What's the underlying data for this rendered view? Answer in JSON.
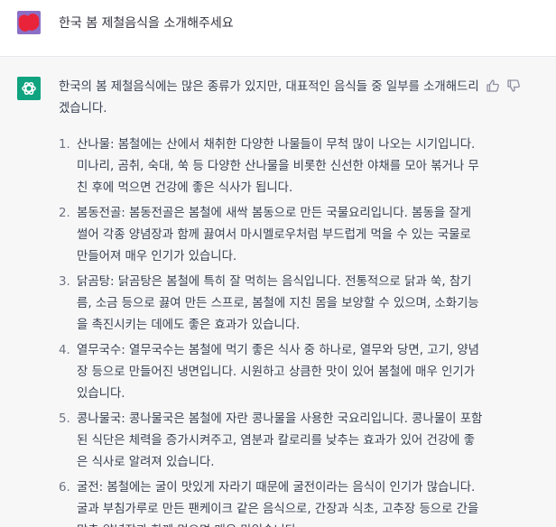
{
  "user_message": {
    "text": "한국 봄 제철음식을 소개해주세요",
    "avatar_color": "#8b6fc6"
  },
  "assistant_message": {
    "avatar_color": "#10a37f",
    "intro": "한국의 봄 제철음식에는 많은 종류가 있지만, 대표적인 음식들 중 일부를 소개해드리겠습니다.",
    "items": [
      {
        "num": "1.",
        "text": "산나물: 봄철에는 산에서 채취한 다양한 나물들이 무척 많이 나오는 시기입니다. 미나리, 곰취, 숙대, 쑥 등 다양한 산나물을 비롯한 신선한 야채를 모아 볶거나 무친 후에 먹으면 건강에 좋은 식사가 됩니다."
      },
      {
        "num": "2.",
        "text": "봄동전골: 봄동전골은 봄철에 새싹 봄동으로 만든 국물요리입니다. 봄동을 잘게 썰어 각종 양념장과 함께 끓여서 마시멜로우처럼 부드럽게 먹을 수 있는 국물로 만들어져 매우 인기가 있습니다."
      },
      {
        "num": "3.",
        "text": "닭곰탕: 닭곰탕은 봄철에 특히 잘 먹히는 음식입니다. 전통적으로 닭과 쑥, 참기름, 소금 등으로 끓여 만든 스프로, 봄철에 지친 몸을 보양할 수 있으며, 소화기능을 촉진시키는 데에도 좋은 효과가 있습니다."
      },
      {
        "num": "4.",
        "text": "열무국수: 열무국수는 봄철에 먹기 좋은 식사 중 하나로, 열무와 당면, 고기, 양념장 등으로 만들어진 냉면입니다. 시원하고 상큼한 맛이 있어 봄철에 매우 인기가 있습니다."
      },
      {
        "num": "5.",
        "text": "콩나물국: 콩나물국은 봄철에 자란 콩나물을 사용한 국요리입니다. 콩나물이 포함된 식단은 체력을 증가시켜주고, 염분과 칼로리를 낮추는 효과가 있어 건강에 좋은 식사로 알려져 있습니다."
      },
      {
        "num": "6.",
        "text": "굴전: 봄철에는 굴이 맛있게 자라기 때문에 굴전이라는 음식이 인기가 많습니다. 굴과 부침가루로 만든 팬케이크 같은 음식으로, 간장과 식초, 고추장 등으로 간을 맞춘 양념장과 함께 먹으면 매우 맛있습니다."
      }
    ]
  },
  "icons": {
    "assistant": "openai-logo-icon",
    "user": "user-avatar-icon",
    "like": "thumbs-up-icon",
    "dislike": "thumbs-down-icon"
  }
}
